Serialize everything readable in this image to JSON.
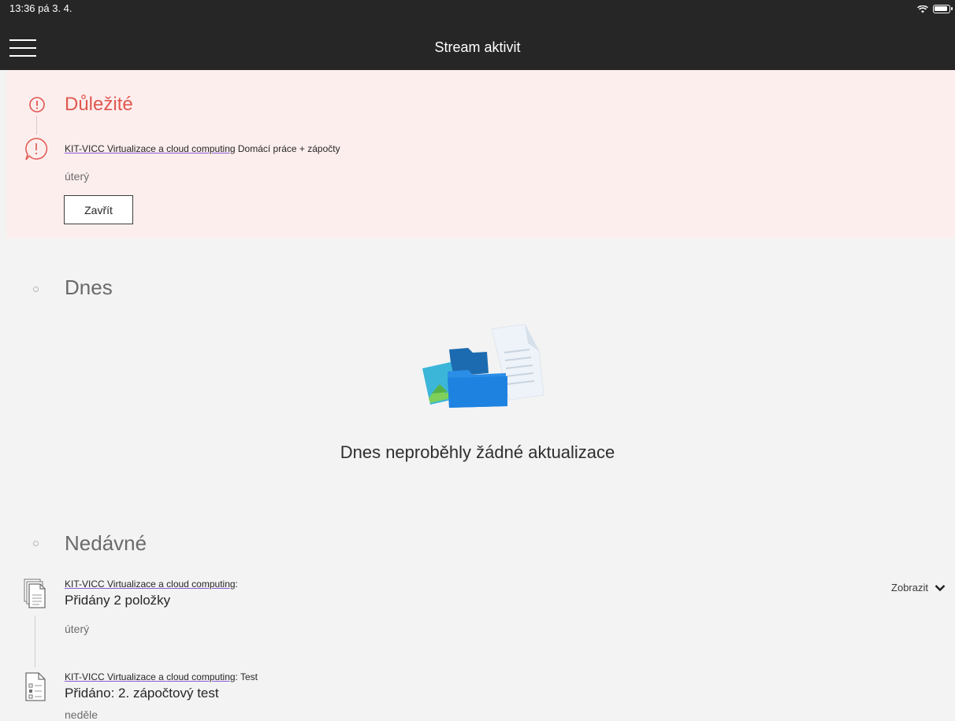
{
  "status": {
    "time": "13:36  pá 3. 4."
  },
  "header": {
    "title": "Stream aktivit"
  },
  "important": {
    "title": "Důležité",
    "item": {
      "course": "KIT-VICC Virtualizace a cloud computing",
      "text": " Domácí práce + zápočty"
    },
    "date": "úterý",
    "close_label": "Zavřít"
  },
  "today": {
    "title": "Dnes",
    "empty_message": "Dnes neproběhly žádné aktualizace"
  },
  "recent": {
    "title": "Nedávné",
    "show_label": "Zobrazit",
    "items": [
      {
        "course": "KIT-VICC Virtualizace a cloud computing",
        "suffix": ":",
        "title": "Přidány 2 položky",
        "date": "úterý",
        "icon": "documents-icon"
      },
      {
        "course": "KIT-VICC Virtualizace a cloud computing",
        "suffix": ": Test",
        "title": "Přidáno: 2. zápočtový test",
        "date": "neděle",
        "icon": "test-icon"
      }
    ]
  },
  "colors": {
    "header_bg": "#262626",
    "important_bg": "#fdeeee",
    "important_accent": "#e0584f",
    "page_bg": "#f3f3f3"
  }
}
